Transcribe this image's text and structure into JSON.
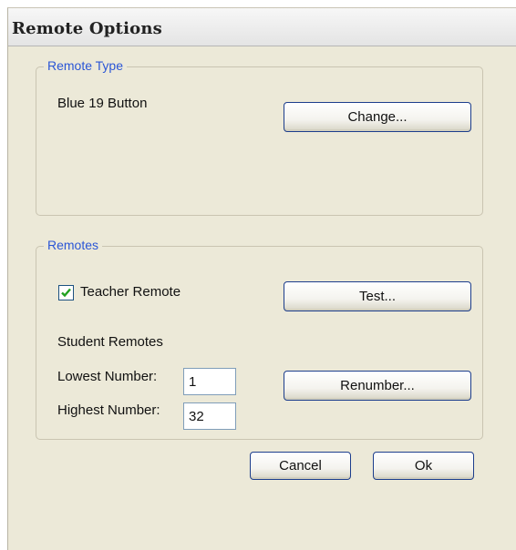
{
  "window": {
    "title": "Remote Options"
  },
  "remote_type": {
    "legend": "Remote Type",
    "current": "Blue 19 Button",
    "change_label": "Change..."
  },
  "remotes": {
    "legend": "Remotes",
    "teacher_label": "Teacher Remote",
    "teacher_checked": true,
    "test_label": "Test...",
    "student_label": "Student Remotes",
    "lowest_label": "Lowest Number:",
    "lowest_value": "1",
    "highest_label": "Highest Number:",
    "highest_value": "32",
    "renumber_label": "Renumber..."
  },
  "footer": {
    "cancel_label": "Cancel",
    "ok_label": "Ok"
  },
  "colors": {
    "legend": "#2b56d6",
    "button_border": "#1c3d8c",
    "dialog_bg": "#ece9d8"
  }
}
